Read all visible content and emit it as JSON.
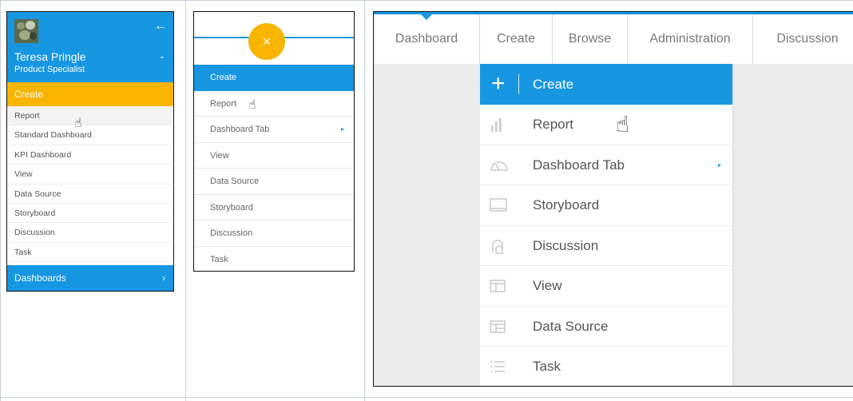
{
  "panel1": {
    "user_name": "Teresa Pringle",
    "user_role": "Product Specialist",
    "back_glyph": "←",
    "chevron_glyph": "⌄",
    "create_label": "Create",
    "items": [
      {
        "label": "Report"
      },
      {
        "label": "Standard Dashboard"
      },
      {
        "label": "KPI Dashboard"
      },
      {
        "label": "View"
      },
      {
        "label": "Data Source"
      },
      {
        "label": "Storyboard"
      },
      {
        "label": "Discussion"
      },
      {
        "label": "Task"
      }
    ],
    "dashboards_label": "Dashboards",
    "dashboards_chevron": "›"
  },
  "panel2": {
    "fab_glyph": "×",
    "items": [
      {
        "label": "Create"
      },
      {
        "label": "Report"
      },
      {
        "label": "Dashboard Tab",
        "submenu_glyph": "▸"
      },
      {
        "label": "View"
      },
      {
        "label": "Data Source"
      },
      {
        "label": "Storyboard"
      },
      {
        "label": "Discussion"
      },
      {
        "label": "Task"
      }
    ]
  },
  "panel3": {
    "nav": [
      {
        "label": "Dashboard"
      },
      {
        "label": "Create"
      },
      {
        "label": "Browse"
      },
      {
        "label": "Administration"
      },
      {
        "label": "Discussion"
      }
    ],
    "dropdown_header": "Create",
    "plus_glyph": "+",
    "items": [
      {
        "label": "Report",
        "icon": "bar-chart-icon"
      },
      {
        "label": "Dashboard Tab",
        "icon": "gauge-icon",
        "submenu_glyph": "▸"
      },
      {
        "label": "Storyboard",
        "icon": "storyboard-icon"
      },
      {
        "label": "Discussion",
        "icon": "discussion-icon"
      },
      {
        "label": "View",
        "icon": "view-icon"
      },
      {
        "label": "Data Source",
        "icon": "data-source-icon"
      },
      {
        "label": "Task",
        "icon": "task-list-icon"
      }
    ]
  },
  "cursor_glyph": "☝",
  "colors": {
    "primary_blue": "#1796e1",
    "accent_yellow": "#f7b500"
  }
}
